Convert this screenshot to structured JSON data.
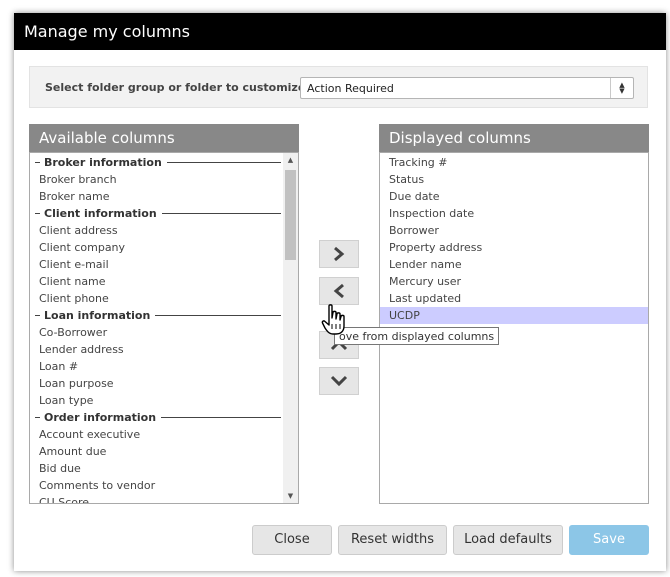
{
  "dialog": {
    "title": "Manage my columns"
  },
  "selector": {
    "label": "Select folder group or folder to customize",
    "value": "Action Required"
  },
  "available": {
    "header": "Available columns",
    "items": [
      {
        "label": "Broker information",
        "group": true
      },
      {
        "label": "Broker branch",
        "group": false
      },
      {
        "label": "Broker name",
        "group": false
      },
      {
        "label": "Client information",
        "group": true
      },
      {
        "label": "Client address",
        "group": false
      },
      {
        "label": "Client company",
        "group": false
      },
      {
        "label": "Client e-mail",
        "group": false
      },
      {
        "label": "Client name",
        "group": false
      },
      {
        "label": "Client phone",
        "group": false
      },
      {
        "label": "Loan information",
        "group": true
      },
      {
        "label": "Co-Borrower",
        "group": false
      },
      {
        "label": "Lender address",
        "group": false
      },
      {
        "label": "Loan #",
        "group": false
      },
      {
        "label": "Loan purpose",
        "group": false
      },
      {
        "label": "Loan type",
        "group": false
      },
      {
        "label": "Order information",
        "group": true
      },
      {
        "label": "Account executive",
        "group": false
      },
      {
        "label": "Amount due",
        "group": false
      },
      {
        "label": "Bid due",
        "group": false
      },
      {
        "label": "Comments to vendor",
        "group": false
      },
      {
        "label": "CU Score",
        "group": false
      }
    ]
  },
  "displayed": {
    "header": "Displayed columns",
    "selected_index": 9,
    "items": [
      "Tracking #",
      "Status",
      "Due date",
      "Inspection date",
      "Borrower",
      "Property address",
      "Lender name",
      "Mercury user",
      "Last updated",
      "UCDP"
    ]
  },
  "tooltip": {
    "text": "ove from displayed columns"
  },
  "footer": {
    "close": "Close",
    "reset": "Reset widths",
    "defaults": "Load defaults",
    "save": "Save"
  },
  "colors": {
    "titlebar": "#000000",
    "panel_header": "#888888",
    "selected_row": "#ccccff",
    "save_button": "#8cc6e7"
  }
}
